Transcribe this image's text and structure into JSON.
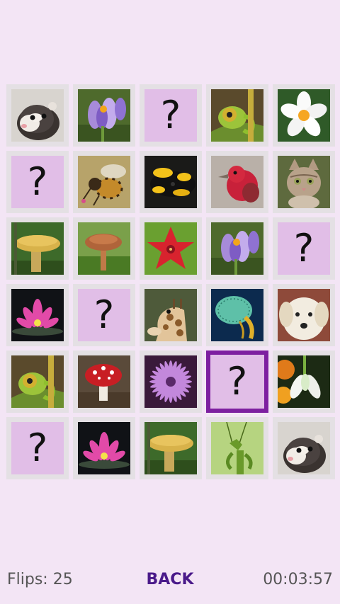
{
  "game": {
    "hidden_symbol": "?",
    "tiles": [
      {
        "state": "revealed",
        "icon": "ferret-icon"
      },
      {
        "state": "revealed",
        "icon": "crocus-icon"
      },
      {
        "state": "hidden"
      },
      {
        "state": "revealed",
        "icon": "chameleon-icon"
      },
      {
        "state": "revealed",
        "icon": "white-flower-icon"
      },
      {
        "state": "hidden"
      },
      {
        "state": "revealed",
        "icon": "bee-icon"
      },
      {
        "state": "revealed",
        "icon": "salamander-icon"
      },
      {
        "state": "revealed",
        "icon": "red-bird-icon"
      },
      {
        "state": "revealed",
        "icon": "kitten-icon"
      },
      {
        "state": "revealed",
        "icon": "yellow-mushroom-icon"
      },
      {
        "state": "revealed",
        "icon": "brown-mushroom-icon"
      },
      {
        "state": "revealed",
        "icon": "red-star-flower-icon"
      },
      {
        "state": "revealed",
        "icon": "crocus-icon"
      },
      {
        "state": "hidden"
      },
      {
        "state": "revealed",
        "icon": "water-lily-icon"
      },
      {
        "state": "hidden"
      },
      {
        "state": "revealed",
        "icon": "giraffe-icon"
      },
      {
        "state": "revealed",
        "icon": "jellyfish-icon"
      },
      {
        "state": "revealed",
        "icon": "dog-icon"
      },
      {
        "state": "revealed",
        "icon": "chameleon-icon"
      },
      {
        "state": "revealed",
        "icon": "red-mushroom-icon"
      },
      {
        "state": "revealed",
        "icon": "purple-daisy-icon"
      },
      {
        "state": "hidden",
        "selected": true
      },
      {
        "state": "revealed",
        "icon": "snowdrop-icon"
      },
      {
        "state": "hidden"
      },
      {
        "state": "revealed",
        "icon": "water-lily-icon"
      },
      {
        "state": "revealed",
        "icon": "yellow-mushroom-icon"
      },
      {
        "state": "revealed",
        "icon": "mantis-icon"
      },
      {
        "state": "revealed",
        "icon": "ferret-icon"
      }
    ]
  },
  "footer": {
    "flips_label": "Flips: 25",
    "back_label": "BACK",
    "timer": "00:03:57"
  },
  "colors": {
    "background": "#f3e5f5",
    "tile_border": "#e4e0e4",
    "hidden_face": "#e1bee7",
    "selected_border": "#7d1fa0",
    "back_text": "#4a1a8a"
  }
}
